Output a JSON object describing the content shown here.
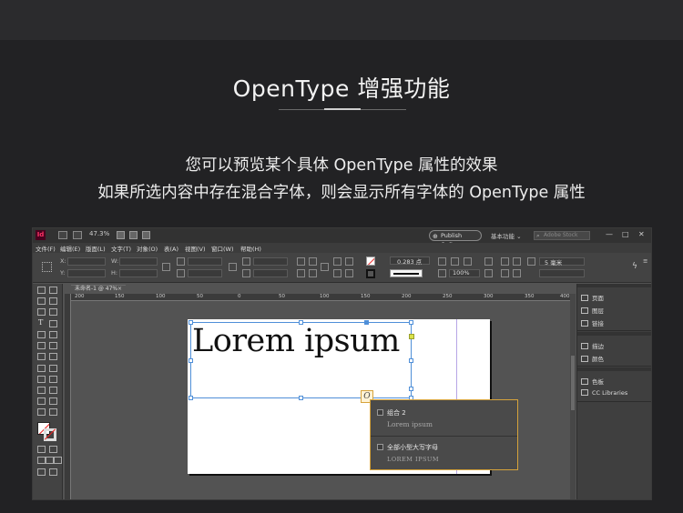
{
  "promo": {
    "title": "OpenType 增强功能",
    "subtitle_line1": "您可以预览某个具体 OpenType 属性的效果",
    "subtitle_line2": "如果所选内容中存在混合字体，则会显示所有字体的 OpenType 属性"
  },
  "app": {
    "logo": "Id",
    "titlebar": {
      "zoom": "47.3%",
      "publish_online": "Publish Online",
      "workspace": "基本功能 ⌄",
      "search_placeholder": "Adobe Stock",
      "minimize": "—",
      "maximize": "□",
      "close": "✕"
    },
    "menu": [
      "文件(F)",
      "编辑(E)",
      "版面(L)",
      "文字(T)",
      "对象(O)",
      "表(A)",
      "视图(V)",
      "窗口(W)",
      "帮助(H)"
    ],
    "control_bar": {
      "x_label": "X:",
      "y_label": "Y:",
      "w_label": "W:",
      "h_label": "H:",
      "stroke_weight": "0.283 点",
      "opacity": "100%",
      "size_value": "5 毫米"
    },
    "document_tab": "未命名-1 @ 47%",
    "document_tab_close": "×",
    "ruler_ticks": [
      "200",
      "150",
      "100",
      "50",
      "0",
      "50",
      "100",
      "150",
      "200",
      "250",
      "300",
      "350",
      "400"
    ],
    "canvas_text": "Lorem ipsum",
    "ot_badge_glyph": "O",
    "opentype_popup": [
      {
        "label": "组合 2",
        "preview": "Lorem ipsum"
      },
      {
        "label": "全部小型大写字母",
        "preview": "LOREM IPSUM"
      }
    ],
    "panels": [
      {
        "items": [
          "页面",
          "图层",
          "链接"
        ]
      },
      {
        "items": [
          "描边",
          "颜色"
        ]
      },
      {
        "items": [
          "色板",
          "CC Libraries"
        ]
      }
    ],
    "colors": {
      "app_bg": "#535353",
      "selection": "#4f8fd8",
      "popup_border": "#d6a33b",
      "logo_bg": "#49021f",
      "logo_fg": "#ff3366"
    }
  }
}
